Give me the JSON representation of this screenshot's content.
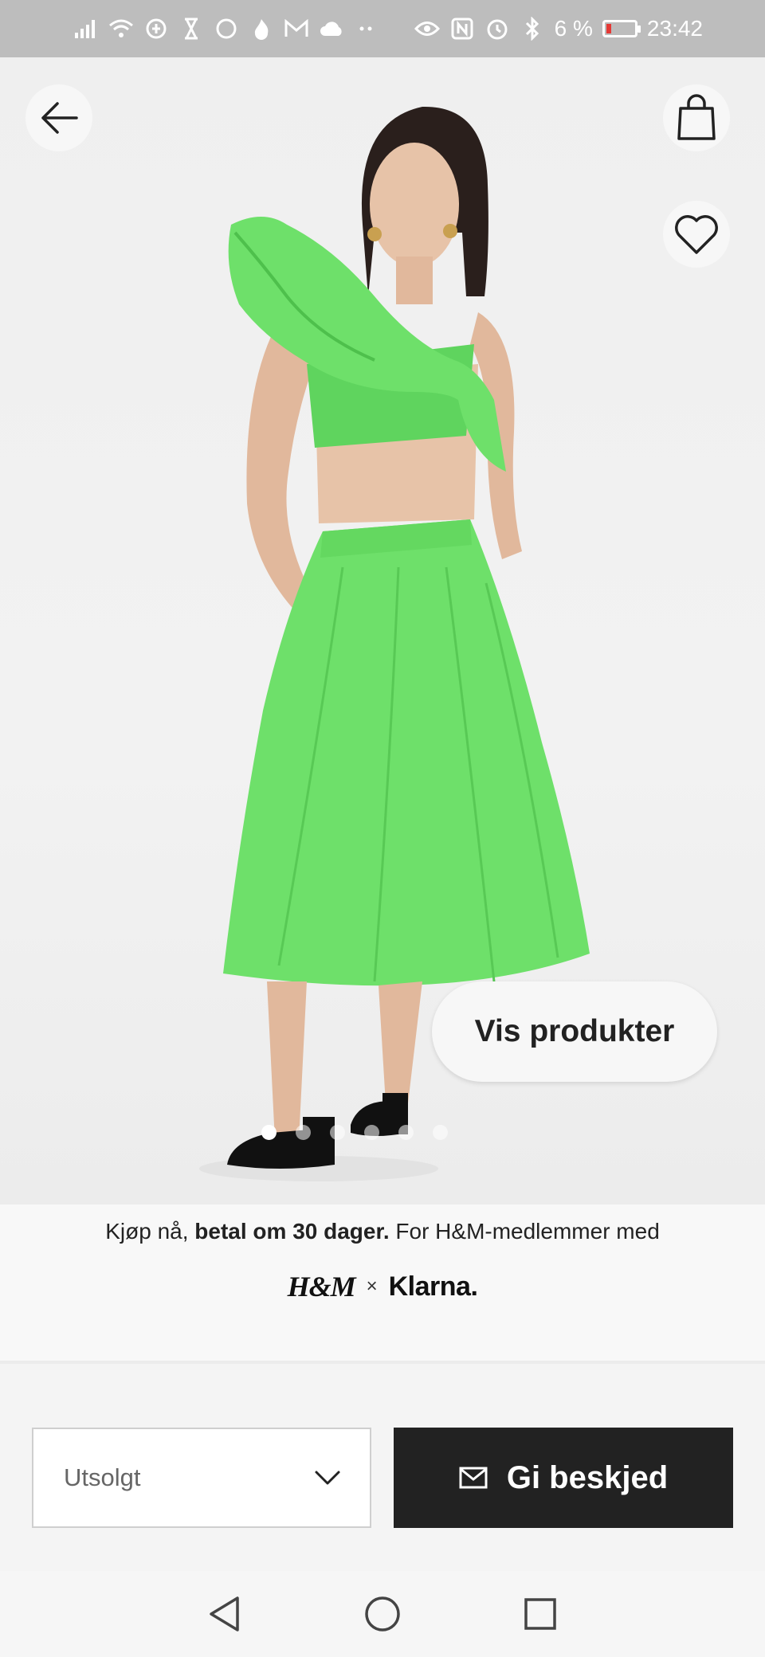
{
  "status_bar": {
    "battery_percent": "6 %",
    "time": "23:42",
    "battery_level": 0.06,
    "left_icons": [
      "signal-icon",
      "wifi-icon",
      "data-saver-icon",
      "hourglass-icon",
      "circle-icon",
      "flame-icon",
      "gmail-icon",
      "cloud-icon",
      "more-dots-icon"
    ],
    "right_icons": [
      "eye-icon",
      "nfc-icon",
      "alarm-icon",
      "bluetooth-icon",
      "battery-icon"
    ]
  },
  "header": {
    "back_icon": "arrow-left-icon",
    "bag_icon": "shopping-bag-icon",
    "favorite_icon": "heart-icon"
  },
  "hero": {
    "vis_produkter_label": "Vis produkter",
    "carousel_count": 6,
    "carousel_active": 0
  },
  "klarna_banner": {
    "text_part1": "Kjøp nå, ",
    "text_bold": "betal om 30 dager.",
    "text_part2": " For H&M-medlemmer med",
    "hm_logo": "H&M",
    "times": "×",
    "klarna_logo": "Klarna."
  },
  "actions": {
    "size_select_value": "Utsolgt",
    "notify_label": "Gi beskjed"
  },
  "colors": {
    "garment_green": "#6ee06a",
    "dark_button": "#222222",
    "status_bar": "#bdbdbd"
  }
}
